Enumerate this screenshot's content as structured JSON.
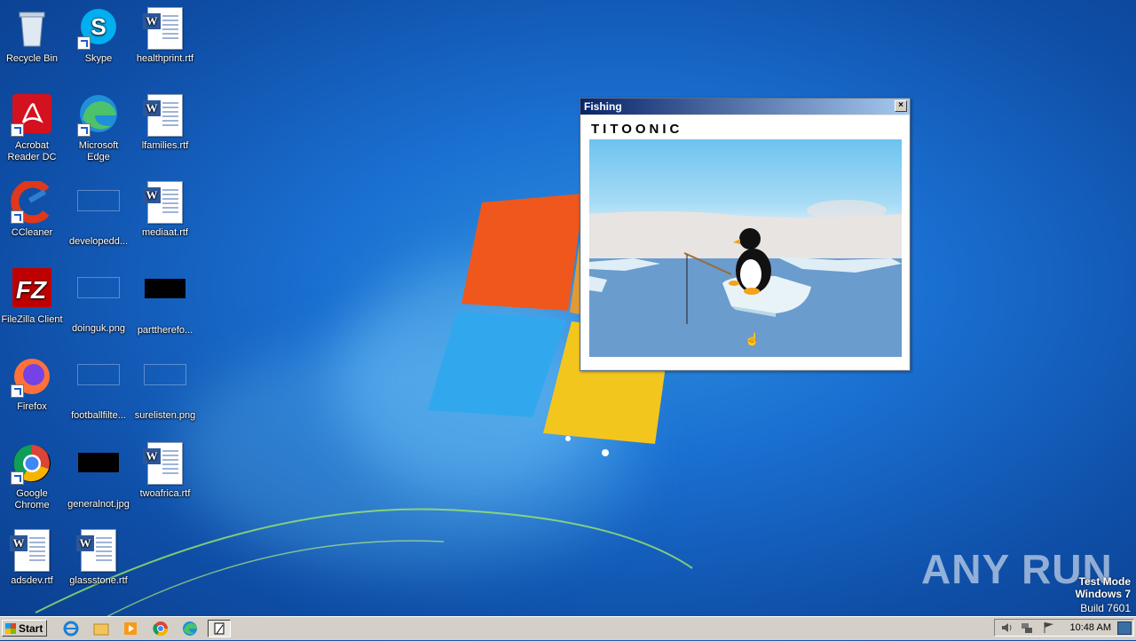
{
  "desktop_icons": [
    {
      "label": "Recycle Bin",
      "icon": "recycle-bin-icon"
    },
    {
      "label": "Skype",
      "icon": "skype-icon"
    },
    {
      "label": "healthprint.rtf",
      "icon": "rtf-file-icon"
    },
    {
      "label": "Acrobat Reader DC",
      "icon": "acrobat-icon"
    },
    {
      "label": "Microsoft Edge",
      "icon": "edge-icon"
    },
    {
      "label": "lfamilies.rtf",
      "icon": "rtf-file-icon"
    },
    {
      "label": "CCleaner",
      "icon": "ccleaner-icon"
    },
    {
      "label": "developedd...",
      "icon": "file-icon"
    },
    {
      "label": "mediaat.rtf",
      "icon": "rtf-file-icon"
    },
    {
      "label": "FileZilla Client",
      "icon": "filezilla-icon"
    },
    {
      "label": "doinguk.png",
      "icon": "image-icon"
    },
    {
      "label": "parttherefo...",
      "icon": "image-icon"
    },
    {
      "label": "Firefox",
      "icon": "firefox-icon"
    },
    {
      "label": "footballfilte...",
      "icon": "image-icon"
    },
    {
      "label": "surelisten.png",
      "icon": "image-icon"
    },
    {
      "label": "Google Chrome",
      "icon": "chrome-icon"
    },
    {
      "label": "generalnot.jpg",
      "icon": "image-icon"
    },
    {
      "label": "twoafrica.rtf",
      "icon": "rtf-file-icon"
    },
    {
      "label": "adsdev.rtf",
      "icon": "rtf-file-icon"
    },
    {
      "label": "glassstone.rtf",
      "icon": "rtf-file-icon"
    }
  ],
  "window": {
    "title": "Fishing",
    "close_glyph": "×",
    "brand": "TITOONIC"
  },
  "taskbar": {
    "start_label": "Start",
    "clock": "10:48 AM",
    "pinned": [
      "ie-icon",
      "explorer-icon",
      "media-player-icon",
      "chrome-icon",
      "edge-icon",
      "fishing-window-icon"
    ]
  },
  "watermark": {
    "line1": "Test Mode",
    "line2": "Windows 7",
    "line3": "Build 7601",
    "anyrun": "ANY  RUN"
  }
}
